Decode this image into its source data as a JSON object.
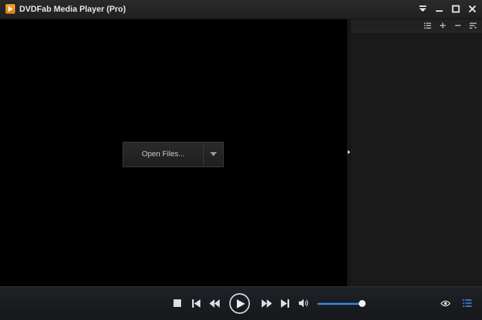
{
  "window": {
    "title": "DVDFab Media Player (Pro)",
    "logo_icon": "play-logo-icon",
    "controls": [
      "menu-icon",
      "minimize-icon",
      "maximize-icon",
      "close-icon"
    ]
  },
  "video": {
    "open_files_label": "Open Files..."
  },
  "playlist": {
    "toolbar_icons": [
      "list-icon",
      "add-icon",
      "remove-icon",
      "sort-icon"
    ]
  },
  "playback": {
    "volume_level": 0.96,
    "accent_color": "#3a7bd5",
    "icons": [
      "stop-icon",
      "previous-icon",
      "rewind-icon",
      "play-icon",
      "fast-forward-icon",
      "next-icon",
      "volume-icon",
      "eye-icon",
      "playlist-toggle-icon"
    ]
  }
}
